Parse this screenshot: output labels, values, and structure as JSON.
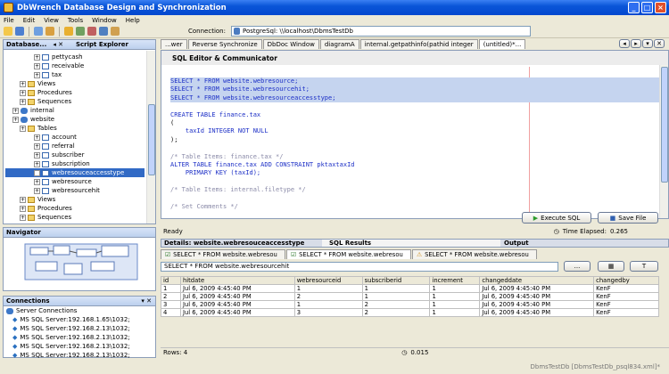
{
  "window": {
    "title": "DbWrench Database Design and Synchronization"
  },
  "menu": [
    "File",
    "Edit",
    "View",
    "Tools",
    "Window",
    "Help"
  ],
  "connection": {
    "label": "Connection:",
    "value": "PostgreSql: \\\\localhost\\DbmsTestDb"
  },
  "db_explorer": {
    "tab1": "Database...",
    "tab2": "Script Explorer",
    "rows": [
      {
        "label": "pettycash",
        "kind": "tbl",
        "indent": 4
      },
      {
        "label": "receivable",
        "kind": "tbl",
        "indent": 4
      },
      {
        "label": "tax",
        "kind": "tbl",
        "indent": 4
      },
      {
        "label": "Views",
        "kind": "fld",
        "indent": 2
      },
      {
        "label": "Procedures",
        "kind": "fld",
        "indent": 2
      },
      {
        "label": "Sequences",
        "kind": "fld",
        "indent": 2
      },
      {
        "label": "internal",
        "kind": "db",
        "indent": 1
      },
      {
        "label": "website",
        "kind": "db",
        "indent": 1
      },
      {
        "label": "Tables",
        "kind": "fld",
        "indent": 2
      },
      {
        "label": "account",
        "kind": "tbl",
        "indent": 4
      },
      {
        "label": "referral",
        "kind": "tbl",
        "indent": 4
      },
      {
        "label": "subscriber",
        "kind": "tbl",
        "indent": 4
      },
      {
        "label": "subscription",
        "kind": "tbl",
        "indent": 4
      },
      {
        "label": "webresouceaccesstype",
        "kind": "tbl",
        "indent": 4,
        "selected": true
      },
      {
        "label": "webresource",
        "kind": "tbl",
        "indent": 4
      },
      {
        "label": "webresourcehit",
        "kind": "tbl",
        "indent": 4
      },
      {
        "label": "Views",
        "kind": "fld",
        "indent": 2
      },
      {
        "label": "Procedures",
        "kind": "fld",
        "indent": 2
      },
      {
        "label": "Sequences",
        "kind": "fld",
        "indent": 2
      }
    ]
  },
  "navigator": {
    "title": "Navigator"
  },
  "connections": {
    "title": "Connections",
    "root": "Server Connections",
    "items": [
      "MS SQL Server:192.168.1.65\\1032;",
      "MS SQL Server:192.168.2.13\\1032;",
      "MS SQL Server:192.168.2.13\\1032;",
      "MS SQL Server:192.168.2.13\\1032;",
      "MS SQL Server:192.168.2.13\\1032;"
    ]
  },
  "editor_tabs": [
    "...wer",
    "Reverse Synchronize",
    "DbDoc Window",
    "diagramA",
    "internal.getpathinfo(pathid integer",
    "(untitled)*..."
  ],
  "editor": {
    "title": "SQL Editor & Communicator",
    "lines": [
      {
        "t": "SELECT * FROM website.webresource;",
        "c": "hl"
      },
      {
        "t": "SELECT * FROM website.webresourcehit;",
        "c": "hl"
      },
      {
        "t": "SELECT * FROM website.webresourceaccesstype;",
        "c": "hl"
      },
      {
        "t": "",
        "c": ""
      },
      {
        "t": "CREATE TABLE finance.tax",
        "c": "kw"
      },
      {
        "t": "(",
        "c": ""
      },
      {
        "t": "    taxId INTEGER NOT NULL",
        "c": "kw"
      },
      {
        "t": ");",
        "c": ""
      },
      {
        "t": "",
        "c": ""
      },
      {
        "t": "/* Table Items: finance.tax */",
        "c": "cm"
      },
      {
        "t": "ALTER TABLE finance.tax ADD CONSTRAINT pktaxtaxId",
        "c": "kw"
      },
      {
        "t": "    PRIMARY KEY (taxId);",
        "c": "kw"
      },
      {
        "t": "",
        "c": ""
      },
      {
        "t": "/* Table Items: internal.filetype */",
        "c": "cm"
      },
      {
        "t": "",
        "c": ""
      },
      {
        "t": "/* Set Comments */",
        "c": "cm"
      }
    ],
    "execute": "Execute SQL",
    "save": "Save File"
  },
  "status": {
    "ready": "Ready",
    "elapsed_label": "Time Elapsed:",
    "elapsed": "0.265"
  },
  "results_tabs": {
    "details": "Details: website.webresouceaccesstype",
    "sql": "SQL Results",
    "output": "Output"
  },
  "result_subtabs": [
    "SELECT * FROM website.webresou",
    "SELECT * FROM website.webresou",
    "SELECT * FROM website.webresou"
  ],
  "query": "SELECT * FROM website.webresourcehit",
  "grid": {
    "columns": [
      "id",
      "hitdate",
      "webresourceid",
      "subscriberid",
      "increment",
      "changeddate",
      "changedby"
    ],
    "rows": [
      [
        "1",
        "Jul 6, 2009 4:45:40 PM",
        "1",
        "1",
        "1",
        "Jul 6, 2009 4:45:40 PM",
        "KenF"
      ],
      [
        "2",
        "Jul 6, 2009 4:45:40 PM",
        "2",
        "1",
        "1",
        "Jul 6, 2009 4:45:40 PM",
        "KenF"
      ],
      [
        "3",
        "Jul 6, 2009 4:45:40 PM",
        "1",
        "2",
        "1",
        "Jul 6, 2009 4:45:40 PM",
        "KenF"
      ],
      [
        "4",
        "Jul 6, 2009 4:45:40 PM",
        "3",
        "2",
        "1",
        "Jul 6, 2009 4:45:40 PM",
        "KenF"
      ]
    ]
  },
  "footer": {
    "rows": "Rows: 4",
    "time": "0.015",
    "file": "DbmsTestDb [DbmsTestDb_psql834.xml]*"
  }
}
